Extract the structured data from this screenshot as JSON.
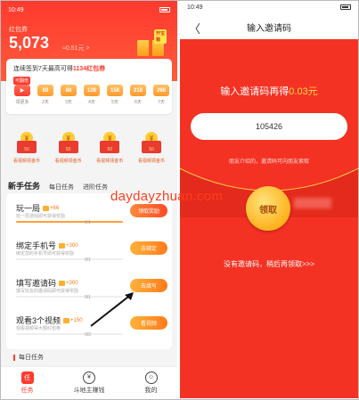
{
  "status_bar": {
    "time": "10:49",
    "signal": "ᵢₗₗ ᵢₗₗ ≈ HD"
  },
  "left": {
    "coupon_label": "红包券",
    "balance": "5,073",
    "balance_delta": "≈0.51元 >",
    "gift_tag": "开宝箱",
    "signin": {
      "title_prefix": "连续签到7天最高可得",
      "title_highlight": "1134红包券",
      "tag": "可翻倍",
      "days": [
        {
          "value": "▶",
          "label": "领更多"
        },
        {
          "value": "68",
          "label": "2天"
        },
        {
          "value": "88",
          "label": "3天"
        },
        {
          "value": "128",
          "label": "4天"
        },
        {
          "value": "158",
          "label": "5天"
        },
        {
          "value": "218",
          "label": "6天"
        },
        {
          "value": "268",
          "label": "7天"
        }
      ]
    },
    "envelopes": [
      {
        "value": "50",
        "label": "看视频领金币"
      },
      {
        "value": "50",
        "label": "看视频领金币"
      },
      {
        "value": "50",
        "label": "看视频领金币"
      },
      {
        "value": "50",
        "label": "看视频领金币"
      }
    ],
    "tabs": {
      "t0": "新手任务",
      "t1": "每日任务",
      "t2": "进阶任务"
    },
    "tasks": [
      {
        "name": "玩一局",
        "reward": "+66",
        "desc": "玩一局游戏即可获得奖励",
        "count": "1/1",
        "progress": 1.0,
        "button": "领取奖励"
      },
      {
        "name": "绑定手机号",
        "reward": "+300",
        "desc": "绑定您的手机号即可获得奖励",
        "count": "0/1",
        "progress": 0.0,
        "button": "去绑定"
      },
      {
        "name": "填写邀请码",
        "reward": "+300",
        "desc": "填写好友的邀请码即可获得奖励",
        "count": "0/1",
        "progress": 0.0,
        "button": "去填写"
      },
      {
        "name": "观看3个视频",
        "reward": "+150",
        "desc": "观看视频得大额红包券",
        "count": "0/3",
        "progress": 0.0,
        "button": "看视频"
      }
    ],
    "daily_header": "每日任务",
    "bottom_nav": [
      {
        "icon": "任",
        "label": "任务",
        "active": true
      },
      {
        "icon": "¥",
        "label": "斗地主赚钱",
        "active": false
      },
      {
        "icon": "☺",
        "label": "我的",
        "active": false
      }
    ]
  },
  "right": {
    "title": "输入邀请码",
    "back": "〈",
    "headline_prefix": "输入邀请码再得",
    "headline_amount": "0.03元",
    "code_value": "105426",
    "hint": "朋友介绍的，邀请码可向朋友索取",
    "claim_button": "领取",
    "skip_link": "没有邀请码，稍后再领取>>>"
  },
  "watermark": "daydayzhuan.com",
  "colors": {
    "primary_red": "#f43224",
    "accent_orange": "#ff7a1a",
    "gold": "#ffd84a"
  }
}
